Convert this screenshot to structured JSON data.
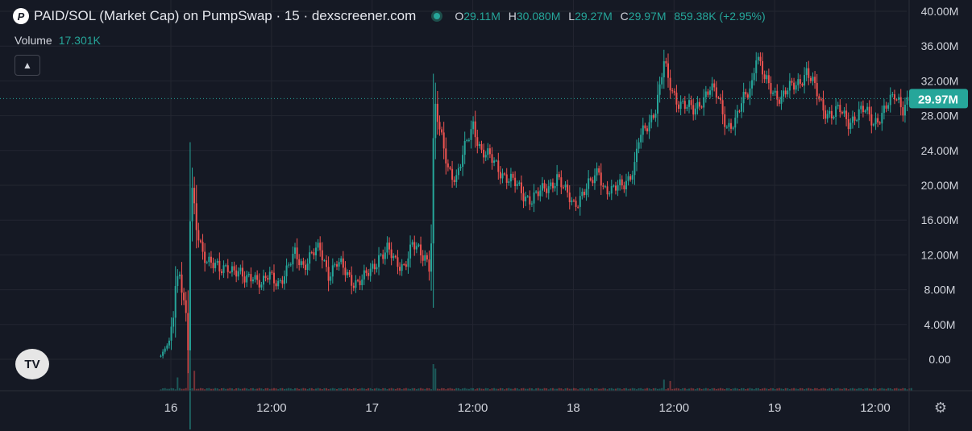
{
  "header": {
    "title": "PAID/SOL (Market Cap) on PumpSwap · 15 · dexscreener.com",
    "ohlc": [
      {
        "k": "O",
        "v": "29.11M"
      },
      {
        "k": "H",
        "v": "30.080M"
      },
      {
        "k": "L",
        "v": "29.27M"
      },
      {
        "k": "C",
        "v": "29.97M"
      }
    ],
    "change": "859.38K (+2.95%)"
  },
  "volume": {
    "label": "Volume",
    "value": "17.301K"
  },
  "colors": {
    "up": "#26a69a",
    "down": "#ef5350",
    "bg": "#151924",
    "grid": "#232631",
    "text": "#d1d4dc"
  },
  "chart_data": {
    "type": "candlestick",
    "y_unit": "market cap (M)",
    "ylim": [
      -4,
      40
    ],
    "yticks": [
      "40.00M",
      "36.00M",
      "32.00M",
      "28.00M",
      "24.00M",
      "20.00M",
      "16.00M",
      "12.00M",
      "8.00M",
      "4.00M",
      "0.00"
    ],
    "ytick_values": [
      40,
      36,
      32,
      28,
      24,
      20,
      16,
      12,
      8,
      4,
      0
    ],
    "xticks": [
      "16",
      "12:00",
      "17",
      "12:00",
      "18",
      "12:00",
      "19",
      "12:00"
    ],
    "xtick_hours": [
      0,
      12,
      24,
      36,
      48,
      60,
      72,
      84
    ],
    "x_range_hours": [
      -9.4,
      88
    ],
    "last_price": 29.97,
    "last_price_label": "29.97M",
    "grid": true,
    "close_series": {
      "start_hour": -1.2,
      "interval_hours": 0.25,
      "points": [
        [
          0,
          0.4
        ],
        [
          4,
          2
        ],
        [
          6,
          5
        ],
        [
          7,
          9
        ],
        [
          9,
          10
        ],
        [
          11,
          7
        ],
        [
          12,
          5
        ],
        [
          13,
          1
        ],
        [
          14,
          16
        ],
        [
          15,
          19
        ],
        [
          17,
          15
        ],
        [
          20,
          12.5
        ],
        [
          24,
          11
        ],
        [
          28,
          10
        ],
        [
          32,
          11
        ],
        [
          36,
          10
        ],
        [
          40,
          9
        ],
        [
          44,
          10
        ],
        [
          48,
          8.5
        ],
        [
          52,
          9.5
        ],
        [
          56,
          9
        ],
        [
          60,
          10
        ],
        [
          64,
          12
        ],
        [
          68,
          11
        ],
        [
          72,
          12
        ],
        [
          76,
          12.5
        ],
        [
          80,
          10
        ],
        [
          84,
          11
        ],
        [
          88,
          10
        ],
        [
          92,
          9
        ],
        [
          96,
          9
        ],
        [
          100,
          10
        ],
        [
          104,
          12
        ],
        [
          108,
          12.5
        ],
        [
          112,
          11
        ],
        [
          116,
          11
        ],
        [
          120,
          13
        ],
        [
          124,
          12
        ],
        [
          126,
          12
        ],
        [
          128,
          11
        ],
        [
          129,
          14
        ],
        [
          130,
          25
        ],
        [
          131,
          29
        ],
        [
          133,
          26
        ],
        [
          137,
          22
        ],
        [
          141,
          21
        ],
        [
          145,
          24
        ],
        [
          149,
          27
        ],
        [
          153,
          24
        ],
        [
          157,
          23
        ],
        [
          161,
          22
        ],
        [
          165,
          21
        ],
        [
          169,
          20
        ],
        [
          173,
          19
        ],
        [
          177,
          18.5
        ],
        [
          181,
          19
        ],
        [
          185,
          20
        ],
        [
          189,
          21
        ],
        [
          193,
          19
        ],
        [
          197,
          18
        ],
        [
          201,
          19
        ],
        [
          205,
          20
        ],
        [
          209,
          22
        ],
        [
          211,
          20
        ],
        [
          215,
          19
        ],
        [
          219,
          20
        ],
        [
          223,
          21
        ],
        [
          226,
          22
        ],
        [
          228,
          25
        ],
        [
          232,
          27
        ],
        [
          236,
          29
        ],
        [
          238,
          31
        ],
        [
          240,
          34
        ],
        [
          242,
          32
        ],
        [
          246,
          30
        ],
        [
          250,
          29
        ],
        [
          254,
          28.5
        ],
        [
          258,
          30
        ],
        [
          262,
          31
        ],
        [
          266,
          30
        ],
        [
          270,
          27
        ],
        [
          274,
          27
        ],
        [
          278,
          30
        ],
        [
          282,
          32
        ],
        [
          284,
          35
        ],
        [
          288,
          32
        ],
        [
          292,
          31
        ],
        [
          296,
          30
        ],
        [
          300,
          31
        ],
        [
          304,
          32
        ],
        [
          308,
          33
        ],
        [
          312,
          31
        ],
        [
          316,
          29
        ],
        [
          320,
          28
        ],
        [
          324,
          28.5
        ],
        [
          328,
          27.5
        ],
        [
          332,
          28
        ],
        [
          336,
          28.5
        ],
        [
          340,
          27.5
        ],
        [
          344,
          28
        ],
        [
          348,
          29.5
        ],
        [
          350,
          30.5
        ],
        [
          352,
          30
        ],
        [
          354,
          29
        ],
        [
          356,
          29.5
        ],
        [
          358,
          29.97
        ]
      ]
    },
    "volume_series": {
      "note": "relative volume bars",
      "spikes": [
        [
          8,
          0.3
        ],
        [
          13,
          0.9
        ],
        [
          16,
          0.45
        ],
        [
          130,
          0.6
        ],
        [
          131,
          0.5
        ],
        [
          240,
          0.25
        ],
        [
          243,
          0.22
        ]
      ]
    }
  },
  "icons": {
    "tv_logo": "tradingview-logo-icon",
    "settings": "gear-icon",
    "collapse": "chevron-up-icon"
  }
}
